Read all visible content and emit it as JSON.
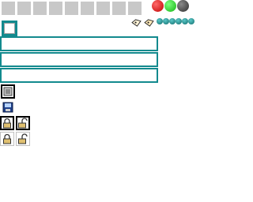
{
  "toolbar": {
    "buttons": [
      "tool-slot-1",
      "tool-slot-2",
      "tool-slot-3",
      "tool-slot-4",
      "tool-slot-5",
      "tool-slot-6",
      "tool-slot-7",
      "tool-slot-8",
      "tool-slot-9"
    ],
    "status_dots": [
      {
        "name": "red-dot-icon",
        "color": "#d01010"
      },
      {
        "name": "green-dot-icon",
        "color": "#22c022"
      },
      {
        "name": "dark-dot-icon",
        "color": "#3a3a3a"
      }
    ]
  },
  "tags": [
    "tag-icon",
    "tag-icon"
  ],
  "beads": [
    "bead-1",
    "bead-2",
    "bead-3",
    "bead-4",
    "bead-5",
    "bead-6"
  ],
  "bars": [
    "bar-1",
    "bar-2",
    "bar-3"
  ],
  "side_icons": [
    "image-icon",
    "save-icon",
    "lock-closed-icon",
    "lock-open-icon",
    "lock-closed-icon",
    "lock-open-icon"
  ],
  "colors": {
    "accent": "#138a8e",
    "button": "#c8c8c8",
    "selection": "#000000"
  }
}
